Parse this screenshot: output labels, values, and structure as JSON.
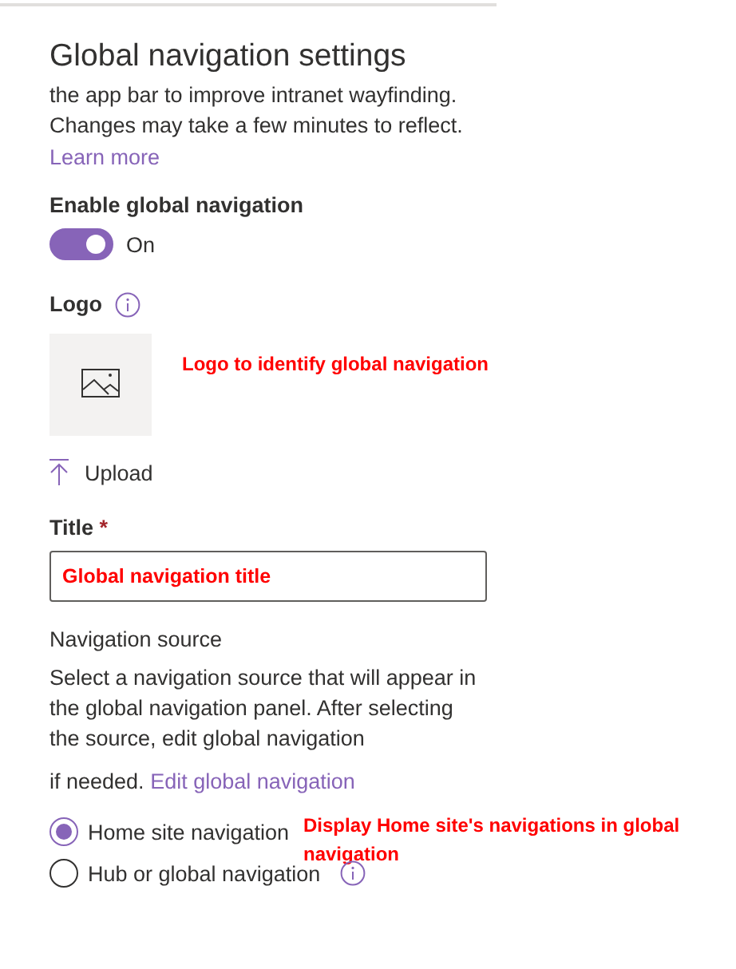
{
  "panel": {
    "title": "Global navigation settings",
    "description": "the app bar to improve intranet wayfinding. Changes may take a few minutes to reflect.",
    "learn_more": "Learn more"
  },
  "toggle": {
    "label": "Enable global navigation",
    "on": true,
    "state_text": "On"
  },
  "logo": {
    "label": "Logo",
    "upload": "Upload",
    "annotation": "Logo to identify global navigation"
  },
  "title_field": {
    "label": "Title",
    "required_mark": "*",
    "value": "Global navigation title"
  },
  "navigation_source": {
    "heading": "Navigation source",
    "description": "Select a navigation source that will appear in the global navigation panel. After selecting the source, edit global navigation",
    "description_end": "if needed.",
    "link": "Edit global navigation",
    "options": [
      {
        "label": "Home site navigation",
        "selected": true,
        "info": false,
        "annotation": "Display Home site's navigations  in global navigation"
      },
      {
        "label": "Hub or global navigation",
        "selected": false,
        "info": true
      }
    ]
  }
}
